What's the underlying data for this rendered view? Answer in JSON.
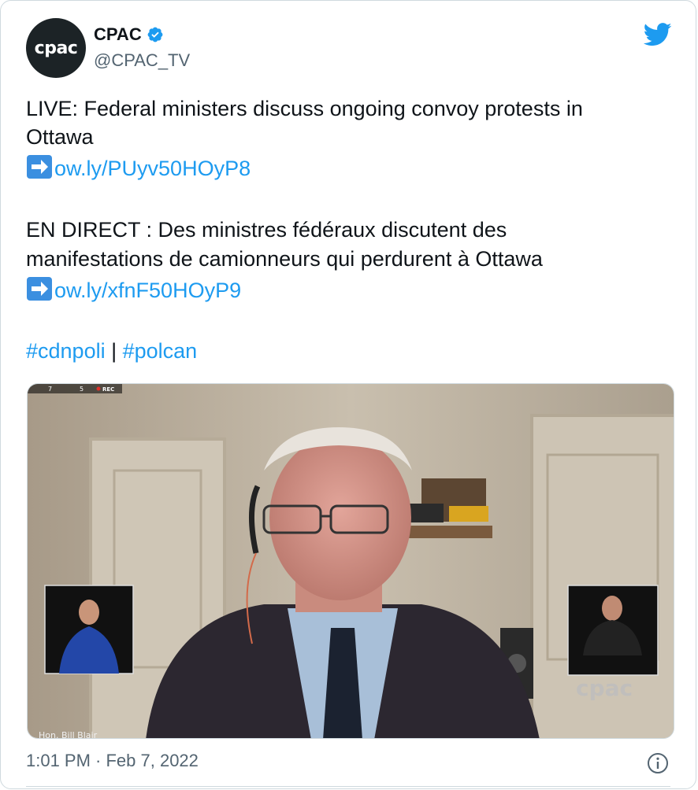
{
  "account": {
    "avatar_text": "cpac",
    "name": "CPAC",
    "handle": "@CPAC_TV"
  },
  "tweet": {
    "line1": "LIVE: Federal ministers discuss ongoing convoy protests in",
    "line2": "Ottawa",
    "link1": "ow.ly/PUyv50HOyP8",
    "line3": "EN DIRECT : Des ministres fédéraux discutent des",
    "line4": "manifestations de camionneurs qui perdurent à Ottawa",
    "link2": "ow.ly/xfnF50HOyP9",
    "hashtag1": "#cdnpoli",
    "separator": " | ",
    "hashtag2": "#polcan"
  },
  "media": {
    "rec_count1": "7",
    "rec_count2": "5",
    "rec_label": "REC",
    "caption": "Hon. Bill Blair",
    "watermark": "cpac"
  },
  "footer": {
    "timestamp": "1:01 PM · Feb 7, 2022"
  },
  "colors": {
    "link": "#1d9bf0",
    "verified": "#1d9bf0",
    "text": "#0f1419",
    "muted": "#536471"
  }
}
